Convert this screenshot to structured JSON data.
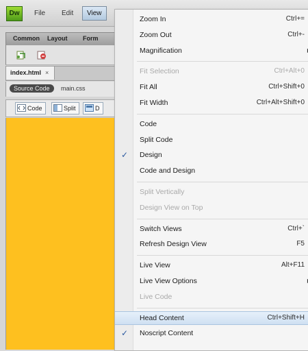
{
  "app": {
    "logo_text": "Dw",
    "menus": {
      "file": "File",
      "edit": "Edit",
      "view": "View"
    },
    "insert_tabs": [
      "Common",
      "Layout",
      "Form"
    ],
    "doc_tab": {
      "name": "index.html",
      "close": "×"
    },
    "related": {
      "source": "Source Code",
      "file": "main.css"
    },
    "view_buttons": {
      "code": "Code",
      "split": "Split",
      "design": "D"
    },
    "canvas_color": "#fec01f"
  },
  "view_menu": {
    "groups": [
      {
        "items": [
          {
            "label": "Zoom In",
            "shortcut": "Ctrl+="
          },
          {
            "label": "Zoom Out",
            "shortcut": "Ctrl+-"
          },
          {
            "label": "Magnification",
            "shortcut": "",
            "submenu": true
          }
        ]
      },
      {
        "items": [
          {
            "label": "Fit Selection",
            "shortcut": "Ctrl+Alt+0",
            "disabled": true
          },
          {
            "label": "Fit All",
            "shortcut": "Ctrl+Shift+0"
          },
          {
            "label": "Fit Width",
            "shortcut": "Ctrl+Alt+Shift+0"
          }
        ]
      },
      {
        "items": [
          {
            "label": "Code",
            "shortcut": ""
          },
          {
            "label": "Split Code",
            "shortcut": ""
          },
          {
            "label": "Design",
            "shortcut": "",
            "checked": true
          },
          {
            "label": "Code and Design",
            "shortcut": ""
          }
        ]
      },
      {
        "items": [
          {
            "label": "Split Vertically",
            "shortcut": "",
            "disabled": true
          },
          {
            "label": "Design View on Top",
            "shortcut": "",
            "disabled": true
          }
        ]
      },
      {
        "items": [
          {
            "label": "Switch Views",
            "shortcut": "Ctrl+`"
          },
          {
            "label": "Refresh Design View",
            "shortcut": "F5"
          }
        ]
      },
      {
        "items": [
          {
            "label": "Live View",
            "shortcut": "Alt+F11"
          },
          {
            "label": "Live View Options",
            "shortcut": "",
            "submenu": true
          },
          {
            "label": "Live Code",
            "shortcut": "",
            "disabled": true
          }
        ]
      },
      {
        "items": [
          {
            "label": "Head Content",
            "shortcut": "Ctrl+Shift+H",
            "highlighted": true
          },
          {
            "label": "Noscript Content",
            "shortcut": "",
            "checked": true
          }
        ]
      }
    ]
  }
}
